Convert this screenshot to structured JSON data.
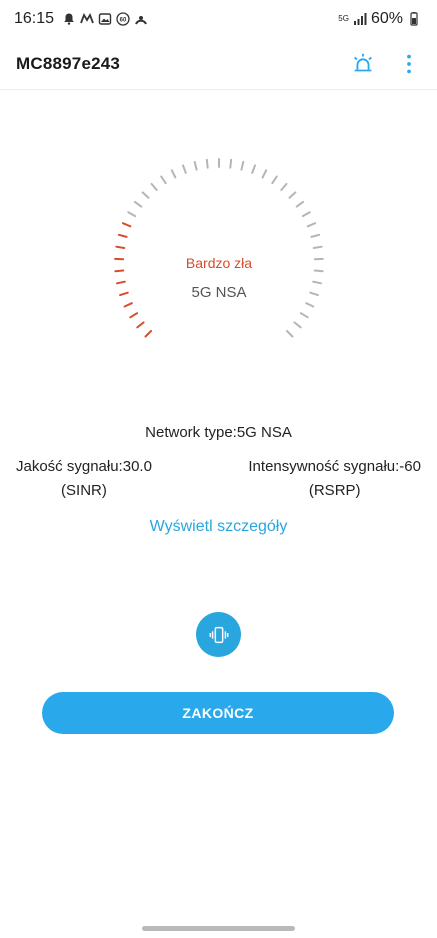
{
  "status_bar": {
    "time": "16:15",
    "notification_icons": [
      "bell-icon",
      "maps-icon",
      "image-icon",
      "sixty-icon",
      "arc-icon"
    ],
    "network_label": "5G",
    "battery": "60%"
  },
  "app_bar": {
    "title": "MC8897e243",
    "alert_icon": "siren-icon",
    "menu_icon": "more-vert-icon"
  },
  "gauge": {
    "quality_label": "Bardzo zła",
    "network_type": "5G NSA",
    "active_color": "#d64c2d",
    "inactive_color": "#b5b5b5"
  },
  "info": {
    "network_type": "Network type:5G NSA",
    "quality_line1": "Jakość sygnału:30.0",
    "quality_line2": "(SINR)",
    "intensity_line1": "Intensywność sygnału:-60",
    "intensity_line2": "(RSRP)"
  },
  "details_link": "Wyświetl szczegóły",
  "vibrate_icon": "vibrate-icon",
  "end_button": "ZAKOŃCZ",
  "colors": {
    "accent": "#29a9eb",
    "danger": "#d64c2d"
  }
}
